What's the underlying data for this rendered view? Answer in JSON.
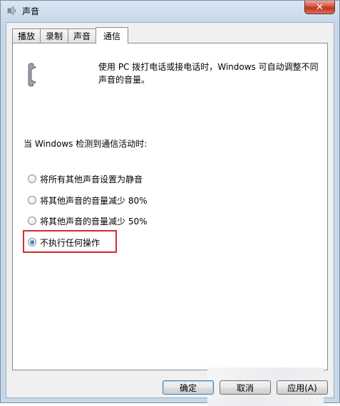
{
  "window": {
    "title": "声音",
    "icon": "speaker-icon",
    "close_label": "✕"
  },
  "tabs": [
    {
      "label": "播放",
      "active": false
    },
    {
      "label": "录制",
      "active": false
    },
    {
      "label": "声音",
      "active": false
    },
    {
      "label": "通信",
      "active": true
    }
  ],
  "panel": {
    "icon": "phone-icon",
    "description": "使用 PC 拨打电话或接电话时，Windows 可自动调整不同声音的音量。",
    "section_label": "当 Windows 检测到通信活动时:",
    "options": [
      {
        "label": "将所有其他声音设置为静音",
        "checked": false
      },
      {
        "label": "将其他声音的音量减少 80%",
        "checked": false
      },
      {
        "label": "将其他声音的音量减少 50%",
        "checked": false
      },
      {
        "label": "不执行任何操作",
        "checked": true
      }
    ],
    "highlight_color": "#d32a2a"
  },
  "buttons": {
    "ok": "确定",
    "cancel": "取消",
    "apply": "应用(A)"
  }
}
